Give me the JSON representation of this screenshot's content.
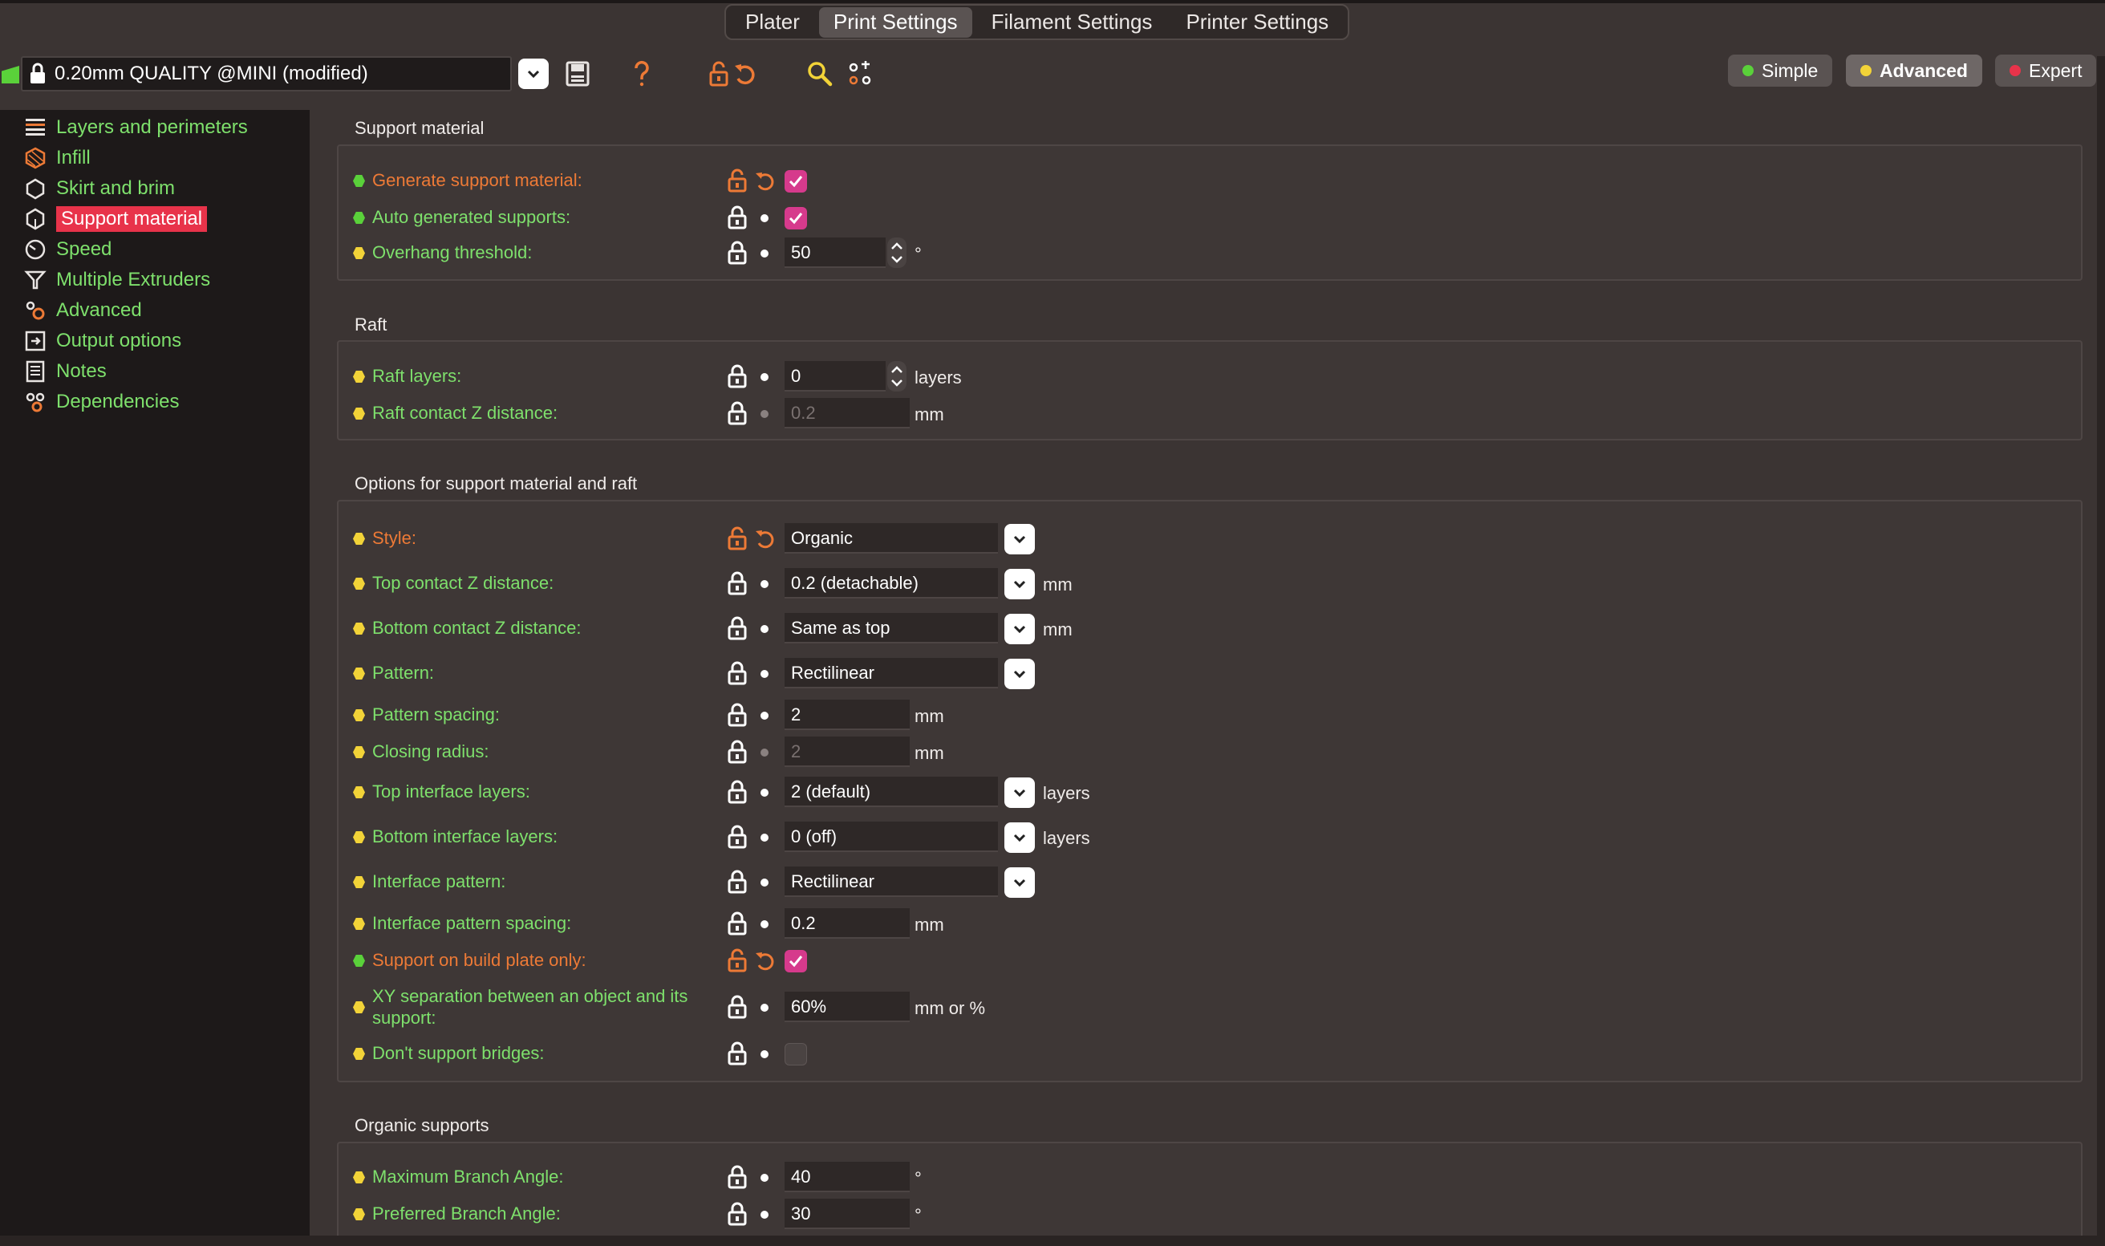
{
  "tabs": [
    {
      "label": "Plater",
      "active": false
    },
    {
      "label": "Print Settings",
      "active": true
    },
    {
      "label": "Filament Settings",
      "active": false
    },
    {
      "label": "Printer Settings",
      "active": false
    }
  ],
  "toolbar": {
    "preset": "0.20mm QUALITY @MINI (modified)",
    "icons": [
      "flag-icon",
      "lock-icon",
      "chevron-down-icon",
      "save-icon",
      "help-icon",
      "unlock-icon",
      "undo-icon",
      "search-icon",
      "compare-icon"
    ]
  },
  "modes": [
    {
      "label": "Simple",
      "color": "#5ad13a",
      "active": false
    },
    {
      "label": "Advanced",
      "color": "#f2d338",
      "active": true
    },
    {
      "label": "Expert",
      "color": "#e8334a",
      "active": false
    }
  ],
  "sidebar": {
    "items": [
      {
        "label": "Layers and perimeters",
        "icon": "layers-icon"
      },
      {
        "label": "Infill",
        "icon": "infill-icon"
      },
      {
        "label": "Skirt and brim",
        "icon": "skirt-icon"
      },
      {
        "label": "Support material",
        "icon": "support-icon",
        "selected": true
      },
      {
        "label": "Speed",
        "icon": "speed-icon"
      },
      {
        "label": "Multiple Extruders",
        "icon": "extruders-icon"
      },
      {
        "label": "Advanced",
        "icon": "advanced-icon"
      },
      {
        "label": "Output options",
        "icon": "output-icon"
      },
      {
        "label": "Notes",
        "icon": "notes-icon"
      },
      {
        "label": "Dependencies",
        "icon": "dependencies-icon"
      }
    ]
  },
  "groups": {
    "support": {
      "title": "Support material",
      "generate": {
        "label": "Generate support material:",
        "checked": true
      },
      "auto": {
        "label": "Auto generated supports:",
        "checked": true
      },
      "overhang": {
        "label": "Overhang threshold:",
        "value": "50",
        "unit": "°"
      }
    },
    "raft": {
      "title": "Raft",
      "layers": {
        "label": "Raft layers:",
        "value": "0",
        "unit": "layers"
      },
      "contact_z": {
        "label": "Raft contact Z distance:",
        "value": "0.2",
        "unit": "mm"
      }
    },
    "options": {
      "title": "Options for support material and raft",
      "style": {
        "label": "Style:",
        "value": "Organic"
      },
      "top_z": {
        "label": "Top contact Z distance:",
        "value": "0.2 (detachable)",
        "unit": "mm"
      },
      "bottom_z": {
        "label": "Bottom contact Z distance:",
        "value": "Same as top",
        "unit": "mm"
      },
      "pattern": {
        "label": "Pattern:",
        "value": "Rectilinear"
      },
      "pattern_spacing": {
        "label": "Pattern spacing:",
        "value": "2",
        "unit": "mm"
      },
      "closing_radius": {
        "label": "Closing radius:",
        "value": "2",
        "unit": "mm"
      },
      "top_iface": {
        "label": "Top interface layers:",
        "value": "2 (default)",
        "unit": "layers"
      },
      "bottom_iface": {
        "label": "Bottom interface layers:",
        "value": "0 (off)",
        "unit": "layers"
      },
      "iface_pattern": {
        "label": "Interface pattern:",
        "value": "Rectilinear"
      },
      "iface_spacing": {
        "label": "Interface pattern spacing:",
        "value": "0.2",
        "unit": "mm"
      },
      "build_plate": {
        "label": "Support on build plate only:",
        "checked": true
      },
      "xy_sep": {
        "label": "XY separation between an object and its support:",
        "value": "60%",
        "unit": "mm or %"
      },
      "bridges": {
        "label": "Don't support bridges:",
        "checked": false
      }
    },
    "organic": {
      "title": "Organic supports",
      "max_angle": {
        "label": "Maximum Branch Angle:",
        "value": "40",
        "unit": "°"
      },
      "pref_angle": {
        "label": "Preferred Branch Angle:",
        "value": "30",
        "unit": "°"
      }
    }
  },
  "colors": {
    "simple": "#5ad13a",
    "advanced": "#f2d338",
    "expert": "#e8334a",
    "label": "#7ee06c",
    "changed_label": "#ed7a36",
    "checkbox": "#d63a8c"
  }
}
